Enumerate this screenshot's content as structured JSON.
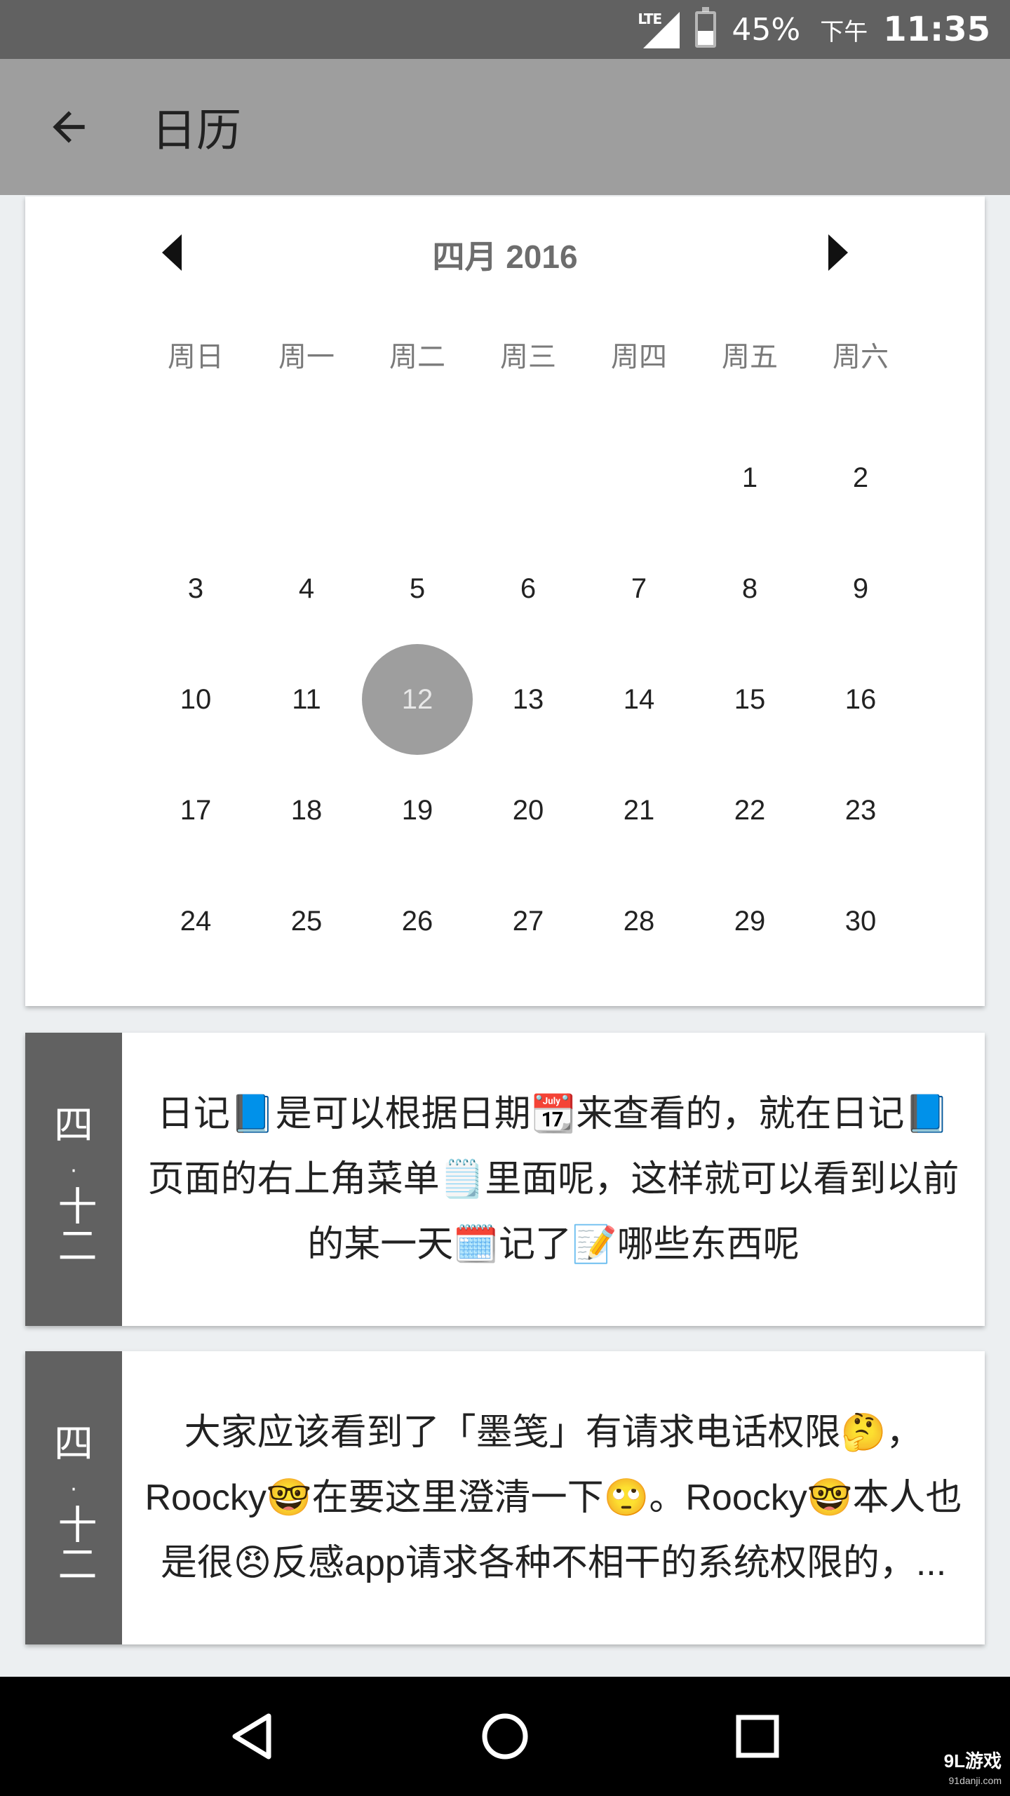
{
  "status_bar": {
    "network": "LTE",
    "battery_percent_label": "45%",
    "battery_level": 0.45,
    "ampm": "下午",
    "time": "11:35"
  },
  "app_bar": {
    "title": "日历",
    "back_icon": "arrow-back-icon"
  },
  "calendar": {
    "month_label": "四月 2016",
    "weekdays": [
      "周日",
      "周一",
      "周二",
      "周三",
      "周四",
      "周五",
      "周六"
    ],
    "days": [
      "",
      "",
      "",
      "",
      "",
      "1",
      "2",
      "3",
      "4",
      "5",
      "6",
      "7",
      "8",
      "9",
      "10",
      "11",
      "12",
      "13",
      "14",
      "15",
      "16",
      "17",
      "18",
      "19",
      "20",
      "21",
      "22",
      "23",
      "24",
      "25",
      "26",
      "27",
      "28",
      "29",
      "30"
    ],
    "selected_day": "12"
  },
  "entries": [
    {
      "date_month": "四",
      "date_dot": "·",
      "date_day": "十二",
      "lines": [
        "日记📘是可以根据日期📆来查看的，就在日记📘",
        "页面的右上角菜单🗒️里面呢，这样就可以看到以前",
        "的某一天🗓️记了📝哪些东西呢"
      ]
    },
    {
      "date_month": "四",
      "date_dot": "·",
      "date_day": "十二",
      "lines": [
        "大家应该看到了「墨笺」有请求电话权限🤔，",
        "Roocky🤓在要这里澄清一下🙄。Roocky🤓本人也",
        "是很😠反感app请求各种不相干的系统权限的，..."
      ]
    }
  ],
  "nav_bar": {
    "back_icon": "nav-back-icon",
    "home_icon": "nav-home-icon",
    "recents_icon": "nav-recents-icon"
  },
  "watermark": {
    "text": "9L游戏",
    "sub": "91danji.com"
  }
}
